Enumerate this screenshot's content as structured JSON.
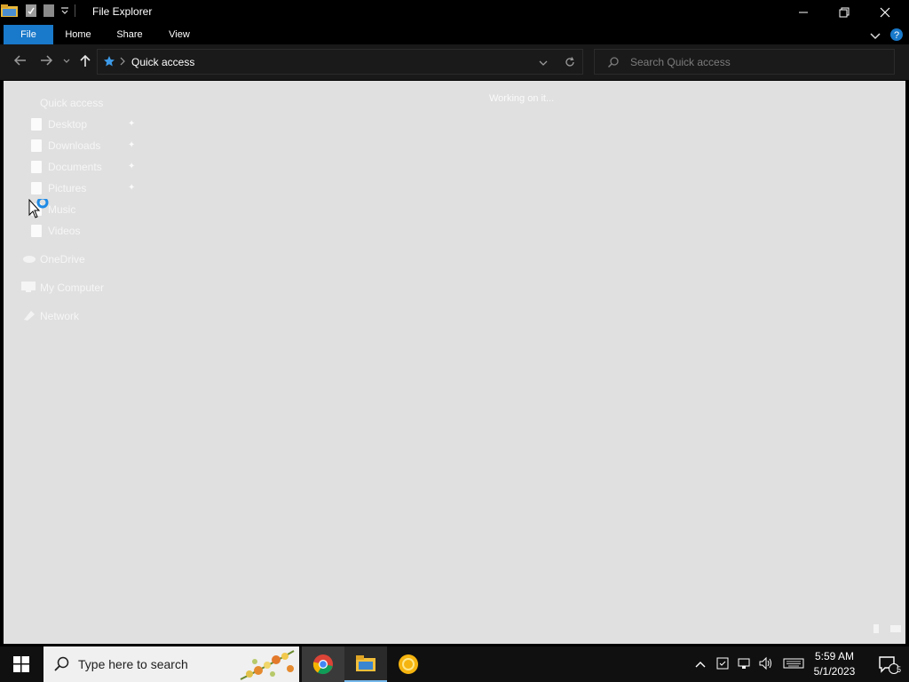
{
  "window": {
    "title": "File Explorer"
  },
  "ribbon": {
    "tabs": [
      "File",
      "Home",
      "Share",
      "View"
    ]
  },
  "address": {
    "crumb": "Quick access"
  },
  "search": {
    "placeholder": "Search Quick access"
  },
  "nav_pane": {
    "quick_access": "Quick access",
    "items": [
      {
        "label": "Desktop",
        "pinned": true
      },
      {
        "label": "Downloads",
        "pinned": true
      },
      {
        "label": "Documents",
        "pinned": true
      },
      {
        "label": "Pictures",
        "pinned": true
      },
      {
        "label": "Music",
        "pinned": false
      },
      {
        "label": "Videos",
        "pinned": false
      }
    ],
    "onedrive": "OneDrive",
    "my_computer": "My Computer",
    "network": "Network"
  },
  "content": {
    "status": "Working on it..."
  },
  "taskbar": {
    "search_text": "Type here to search",
    "time": "5:59 AM",
    "date": "5/1/2023",
    "notification_count": "5"
  },
  "colors": {
    "accent": "#1979ca",
    "content_bg": "#e0e0e0",
    "taskbar_bg": "#101010"
  }
}
